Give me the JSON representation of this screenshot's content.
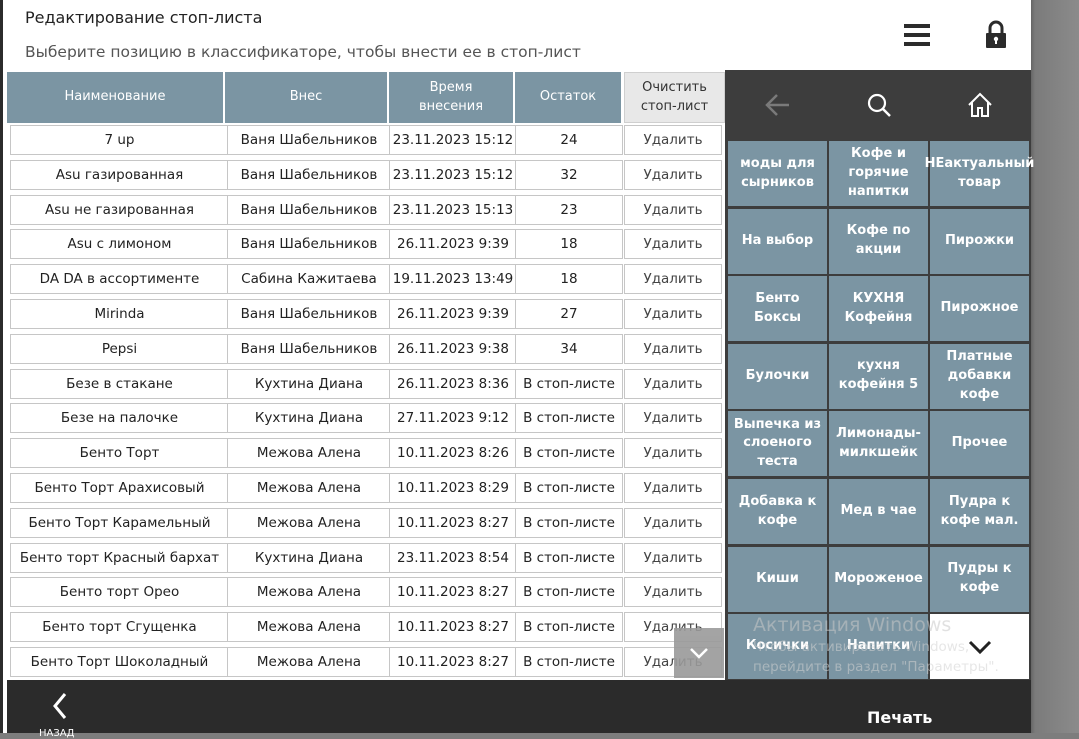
{
  "header": {
    "title": "Редактирование стоп-листа",
    "subtitle": "Выберите позицию в классификаторе, чтобы внести ее в стоп-лист"
  },
  "table": {
    "columns": [
      "Наименование",
      "Внес",
      "Время\nвнесения",
      "Остаток",
      "Очистить\nстоп-лист"
    ],
    "delete_label": "Удалить",
    "rows": [
      {
        "name": "7 up",
        "author": "Ваня Шабельников",
        "time": "23.11.2023 15:12",
        "rest": "24"
      },
      {
        "name": "Asu газированная",
        "author": "Ваня Шабельников",
        "time": "23.11.2023 15:12",
        "rest": "32"
      },
      {
        "name": "Asu не газированная",
        "author": "Ваня Шабельников",
        "time": "23.11.2023 15:13",
        "rest": "23"
      },
      {
        "name": "Asu с лимоном",
        "author": "Ваня Шабельников",
        "time": "26.11.2023 9:39",
        "rest": "18"
      },
      {
        "name": "DA DA в ассортименте",
        "author": "Сабина Кажитаева",
        "time": "19.11.2023 13:49",
        "rest": "18"
      },
      {
        "name": "Mirinda",
        "author": "Ваня Шабельников",
        "time": "26.11.2023 9:39",
        "rest": "27"
      },
      {
        "name": "Pepsi",
        "author": "Ваня Шабельников",
        "time": "26.11.2023 9:38",
        "rest": "34"
      },
      {
        "name": "Безе в стакане",
        "author": "Кухтина Диана",
        "time": "26.11.2023 8:36",
        "rest": "В стоп-листе"
      },
      {
        "name": "Безе на палочке",
        "author": "Кухтина Диана",
        "time": "27.11.2023 9:12",
        "rest": "В стоп-листе"
      },
      {
        "name": "Бенто Торт",
        "author": "Межова Алена",
        "time": "10.11.2023 8:26",
        "rest": "В стоп-листе"
      },
      {
        "name": "Бенто Торт Арахисовый",
        "author": "Межова Алена",
        "time": "10.11.2023 8:29",
        "rest": "В стоп-листе"
      },
      {
        "name": "Бенто Торт Карамельный",
        "author": "Межова Алена",
        "time": "10.11.2023 8:27",
        "rest": "В стоп-листе"
      },
      {
        "name": "Бенто торт Красный бархат",
        "author": "Кухтина Диана",
        "time": "23.11.2023 8:54",
        "rest": "В стоп-листе"
      },
      {
        "name": "Бенто торт Орео",
        "author": "Межова Алена",
        "time": "10.11.2023 8:27",
        "rest": "В стоп-листе"
      },
      {
        "name": "Бенто торт Сгущенка",
        "author": "Межова Алена",
        "time": "10.11.2023 8:27",
        "rest": "В стоп-листе"
      },
      {
        "name": "Бенто Торт Шоколадный",
        "author": "Межова Алена",
        "time": "10.11.2023 8:27",
        "rest": "В стоп-листе"
      }
    ]
  },
  "categories": {
    "tiles": [
      "моды для сырников",
      "Кофе и горячие напитки",
      "НЕактуальный товар",
      "На выбор",
      "Кофе по акции",
      "Пирожки",
      "Бенто Боксы",
      "КУХНЯ Кофейня",
      "Пирожное",
      "Булочки",
      "кухня кофейня 5",
      "Платные добавки кофе",
      "Выпечка из слоеного теста",
      "Лимонады-милкшейк",
      "Прочее",
      "Добавка к кофе",
      "Мед в чае",
      "Пудра к кофе мал.",
      "Киши",
      "Мороженое",
      "Пудры к кофе",
      "Косички",
      "Напитки",
      ""
    ]
  },
  "watermark": {
    "title": "Активация Windows",
    "line1": "Чтобы активировать Windows,",
    "line2": "перейдите в раздел \"Параметры\"."
  },
  "footer": {
    "back_label": "НАЗАД",
    "print_label": "Печать"
  },
  "colors": {
    "accent": "#7b95a3",
    "dark": "#2b2b2b",
    "panel": "#3d3d3d"
  }
}
